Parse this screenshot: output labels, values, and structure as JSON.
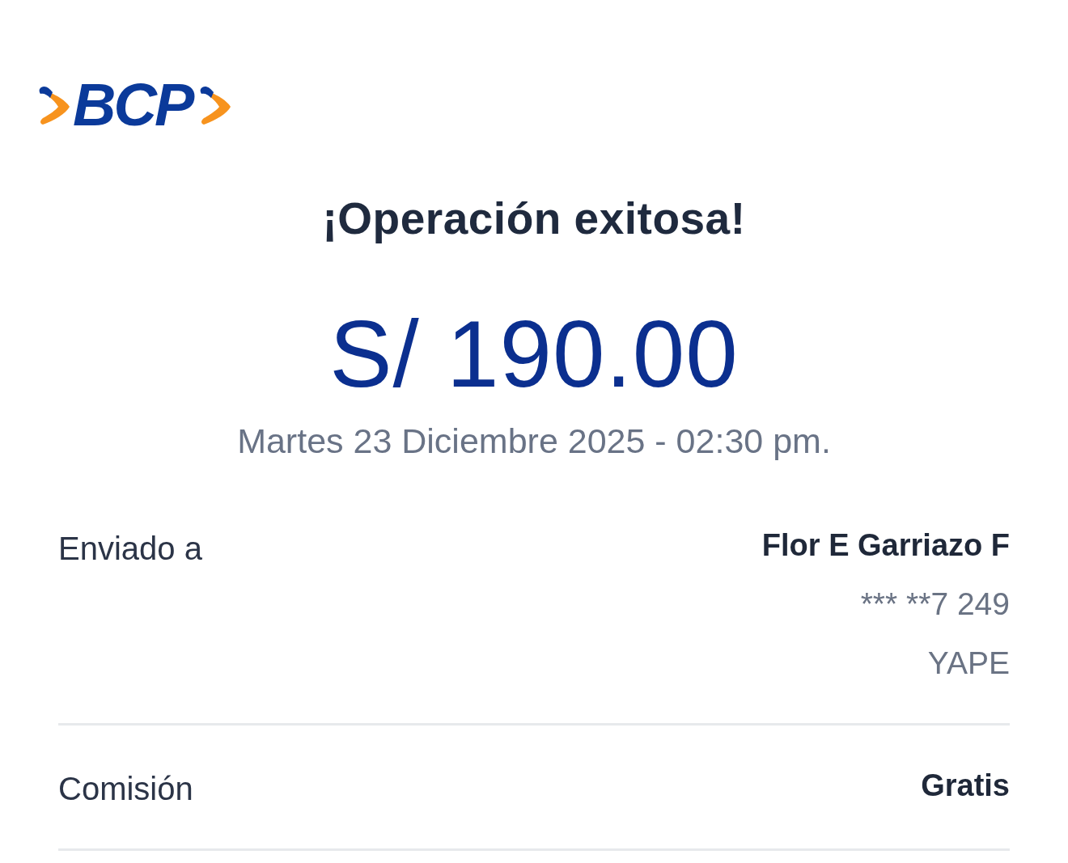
{
  "logo": {
    "text": "BCP"
  },
  "title": "¡Operación exitosa!",
  "amount": "S/ 190.00",
  "datetime": "Martes 23 Diciembre 2025 - 02:30 pm.",
  "details": [
    {
      "label": "Enviado a",
      "values": [
        {
          "text": "Flor E Garriazo F",
          "kind": "primary"
        },
        {
          "text": "*** **7 249",
          "kind": "secondary"
        },
        {
          "text": "YAPE",
          "kind": "secondary"
        }
      ]
    },
    {
      "label": "Comisión",
      "values": [
        {
          "text": "Gratis",
          "kind": "primary"
        }
      ]
    }
  ]
}
